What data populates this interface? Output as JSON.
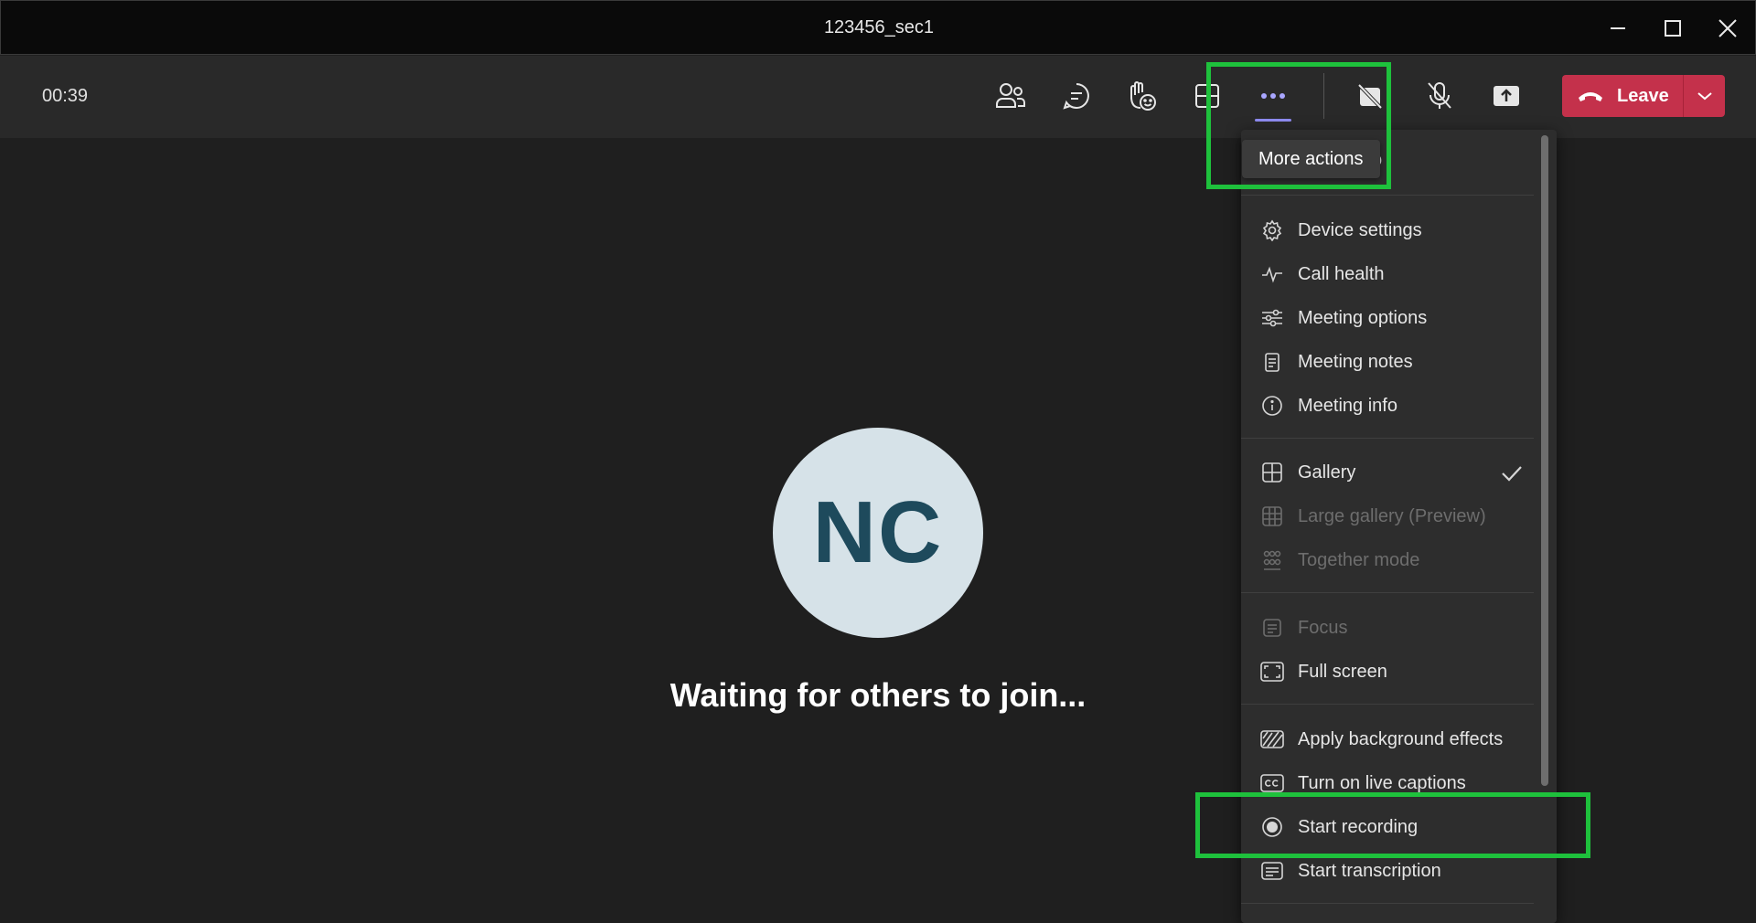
{
  "window": {
    "title": "123456_sec1"
  },
  "toolbar": {
    "timer": "00:39",
    "leave_label": "Leave",
    "icons": [
      "people-icon",
      "chat-icon",
      "raise-hand-icon",
      "view-icon",
      "more-icon",
      "camera-off-icon",
      "mic-off-icon",
      "share-icon"
    ]
  },
  "tooltip": {
    "text": "More actions"
  },
  "stage": {
    "avatar_initials": "NC",
    "waiting_text": "Waiting for others to join..."
  },
  "menu": {
    "partial_text": "o",
    "items": [
      {
        "label": "Device settings",
        "icon": "gear-icon",
        "enabled": true
      },
      {
        "label": "Call health",
        "icon": "pulse-icon",
        "enabled": true
      },
      {
        "label": "Meeting options",
        "icon": "sliders-icon",
        "enabled": true
      },
      {
        "label": "Meeting notes",
        "icon": "notes-icon",
        "enabled": true
      },
      {
        "label": "Meeting info",
        "icon": "info-icon",
        "enabled": true
      },
      {
        "label": "Gallery",
        "icon": "gallery-icon",
        "enabled": true,
        "checked": true
      },
      {
        "label": "Large gallery (Preview)",
        "icon": "large-gallery-icon",
        "enabled": false
      },
      {
        "label": "Together mode",
        "icon": "together-mode-icon",
        "enabled": false
      },
      {
        "label": "Focus",
        "icon": "focus-icon",
        "enabled": false
      },
      {
        "label": "Full screen",
        "icon": "fullscreen-icon",
        "enabled": true
      },
      {
        "label": "Apply background effects",
        "icon": "background-effects-icon",
        "enabled": true
      },
      {
        "label": "Turn on live captions",
        "icon": "captions-icon",
        "enabled": true
      },
      {
        "label": "Start recording",
        "icon": "record-icon",
        "enabled": true
      },
      {
        "label": "Start transcription",
        "icon": "transcription-icon",
        "enabled": true
      }
    ]
  },
  "colors": {
    "highlight": "#1ec13c",
    "leave": "#c4314b",
    "accent": "#8e8bf0"
  }
}
